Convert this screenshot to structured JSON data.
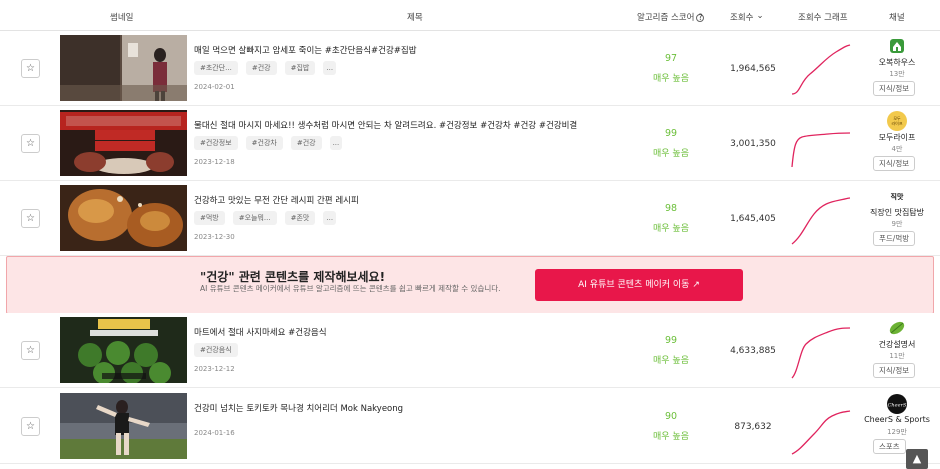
{
  "header": {
    "thumbnail": "썸네일",
    "title": "제목",
    "algorithm_score": "알고리즘 스코어",
    "info_glyph": "?",
    "views": "조회수",
    "views_sort_glyph": "⌄",
    "view_graph": "조회수 그래프",
    "channel": "채널"
  },
  "icons": {
    "star": "star-icon",
    "info": "info-icon",
    "sort": "chevron-down-icon",
    "scroll_top": "arrow-up-icon"
  },
  "colors": {
    "score_green": "#6cbf3a",
    "graph_line": "#e0245e",
    "banner_bg": "#fde5e6",
    "banner_button": "#e8174a"
  },
  "star_glyph": "☆",
  "videos": [
    {
      "title": "매일 먹으면 살빠지고 암세포 죽이는 #초간단음식#건강#집밥",
      "tags": [
        "#초간단...",
        "#건강",
        "#집밥",
        "..."
      ],
      "date": "2024-02-01",
      "score": "97",
      "score_label": "매우 높음",
      "views": "1,964,565",
      "channel": {
        "name": "오복하우스",
        "subscribers": "13만",
        "category": "지식/정보"
      }
    },
    {
      "title": "물대신 절대 마시지 마세요!! 생수처럼 마시면 안되는 차 알려드려요. #건강정보 #건강차 #건강 #건강비결",
      "tags": [
        "#건강정보",
        "#건강차",
        "#건강",
        "..."
      ],
      "date": "2023-12-18",
      "score": "99",
      "score_label": "매우 높음",
      "views": "3,001,350",
      "channel": {
        "name": "모두라이프",
        "subscribers": "4만",
        "category": "지식/정보",
        "logo_text": "모두\n라이프"
      }
    },
    {
      "title": "건강하고 맛있는 무전 간단 레시피 간편 레시피",
      "tags": [
        "#먹방",
        "#오늘뭐...",
        "#존맛",
        "..."
      ],
      "date": "2023-12-30",
      "score": "98",
      "score_label": "매우 높음",
      "views": "1,645,405",
      "channel": {
        "name": "직장인 맛집탐방",
        "subscribers": "9만",
        "category": "푸드/먹방",
        "logo_text": "직맛"
      }
    },
    {
      "title": "마트에서 절대 사지마세요 #건강음식",
      "tags": [
        "#건강음식"
      ],
      "date": "2023-12-12",
      "score": "99",
      "score_label": "매우 높음",
      "views": "4,633,885",
      "channel": {
        "name": "건강설명서",
        "subscribers": "11만",
        "category": "지식/정보"
      }
    },
    {
      "title": "건강미 넘치는 토키토카 목나경 치어리더 Mok Nakyeong",
      "tags": [],
      "date": "2024-01-16",
      "score": "90",
      "score_label": "매우 높음",
      "views": "873,632",
      "channel": {
        "name": "CheerS & Sports",
        "subscribers": "129만",
        "category": "스포츠",
        "logo_text": "CheerS"
      }
    }
  ],
  "banner": {
    "title": "\"건강\" 관련 콘텐츠를 제작해보세요!",
    "subtitle": "AI 유튜브 콘텐츠 메이커에서 유튜브 알고리즘에 뜨는 콘텐츠를 쉽고 빠르게 제작할 수 있습니다.",
    "button": "AI 유튜브 콘텐츠 메이커 이동 ↗"
  },
  "scroll_top_glyph": "▲"
}
